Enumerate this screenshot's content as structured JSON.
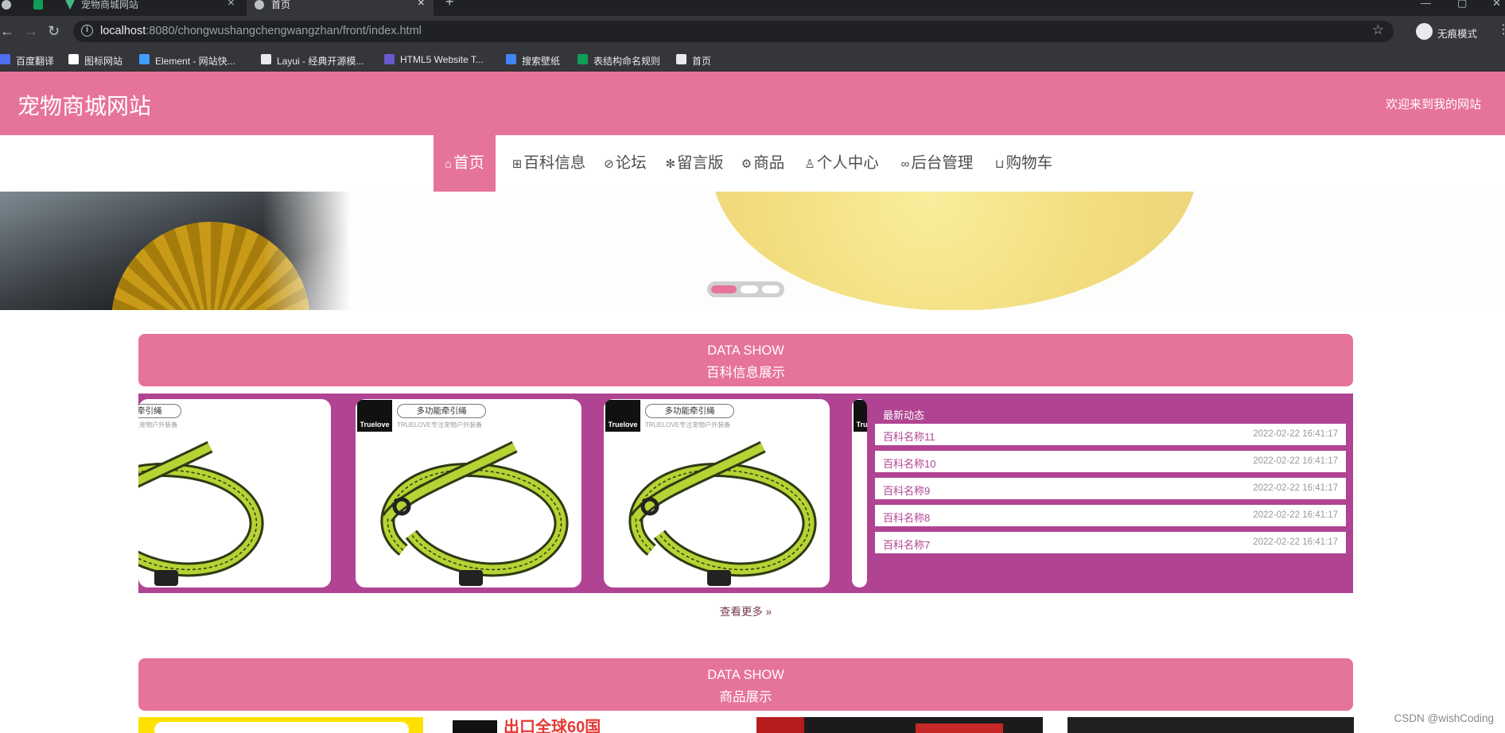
{
  "browser": {
    "tabs": [
      {
        "title": ""
      },
      {
        "title": "宠物商城网站"
      },
      {
        "title": "首页"
      }
    ],
    "url_host": "localhost",
    "url_path": ":8080/chongwushangchengwangzhan/front/index.html",
    "profile_name": "无痕模式",
    "bookmarks": [
      {
        "label": "百度翻译",
        "icon": "translate-icon",
        "color": "#4e6ef2"
      },
      {
        "label": "图标网站",
        "icon": "flag-icon",
        "color": "#ffffff"
      },
      {
        "label": "Element - 网站快...",
        "icon": "element-icon",
        "color": "#409eff"
      },
      {
        "label": "Layui - 经典开源模...",
        "icon": "layui-icon",
        "color": "#e8eaed"
      },
      {
        "label": "HTML5 Website T...",
        "icon": "html5-icon",
        "color": "#6a5acd"
      },
      {
        "label": "搜索壁纸",
        "icon": "wallpaper-icon",
        "color": "#4285f4"
      },
      {
        "label": "表结构命名规则",
        "icon": "sheet-icon",
        "color": "#0f9d58"
      },
      {
        "label": "首页",
        "icon": "globe-icon",
        "color": "#e8eaed"
      }
    ]
  },
  "header": {
    "site_title": "宠物商城网站",
    "welcome": "欢迎来到我的网站"
  },
  "nav": [
    {
      "label": "首页",
      "icon": "⌂",
      "active": true
    },
    {
      "label": "百科信息",
      "icon": "⊞",
      "active": false
    },
    {
      "label": "论坛",
      "icon": "⊘",
      "active": false
    },
    {
      "label": "留言版",
      "icon": "✻",
      "active": false
    },
    {
      "label": "商品",
      "icon": "⚙",
      "active": false
    },
    {
      "label": "个人中心",
      "icon": "♙",
      "active": false
    },
    {
      "label": "后台管理",
      "icon": "∞",
      "active": false
    },
    {
      "label": "购物车",
      "icon": "⊔",
      "active": false
    }
  ],
  "carousel": {
    "slide_count": 3,
    "current": 1
  },
  "wiki_section": {
    "en": "DATA SHOW",
    "cn": "百科信息展示",
    "card": {
      "logo": "Truelove",
      "tag": "多功能牵引绳",
      "sub": "TRUELOVE专注宠物户外装备"
    },
    "news_title": "最新动态",
    "news": [
      {
        "name": "百科名称11",
        "date": "2022-02-22 16:41:17"
      },
      {
        "name": "百科名称10",
        "date": "2022-02-22 16:41:17"
      },
      {
        "name": "百科名称9",
        "date": "2022-02-22 16:41:17"
      },
      {
        "name": "百科名称8",
        "date": "2022-02-22 16:41:17"
      },
      {
        "name": "百科名称7",
        "date": "2022-02-22 16:41:17"
      }
    ],
    "more": "查看更多 »"
  },
  "goods_section": {
    "en": "DATA SHOW",
    "cn": "商品展示",
    "peek_text": "出口全球60国"
  },
  "watermark": "CSDN @wishCoding",
  "colors": {
    "brand": "#e67399",
    "panel": "#b04392"
  }
}
